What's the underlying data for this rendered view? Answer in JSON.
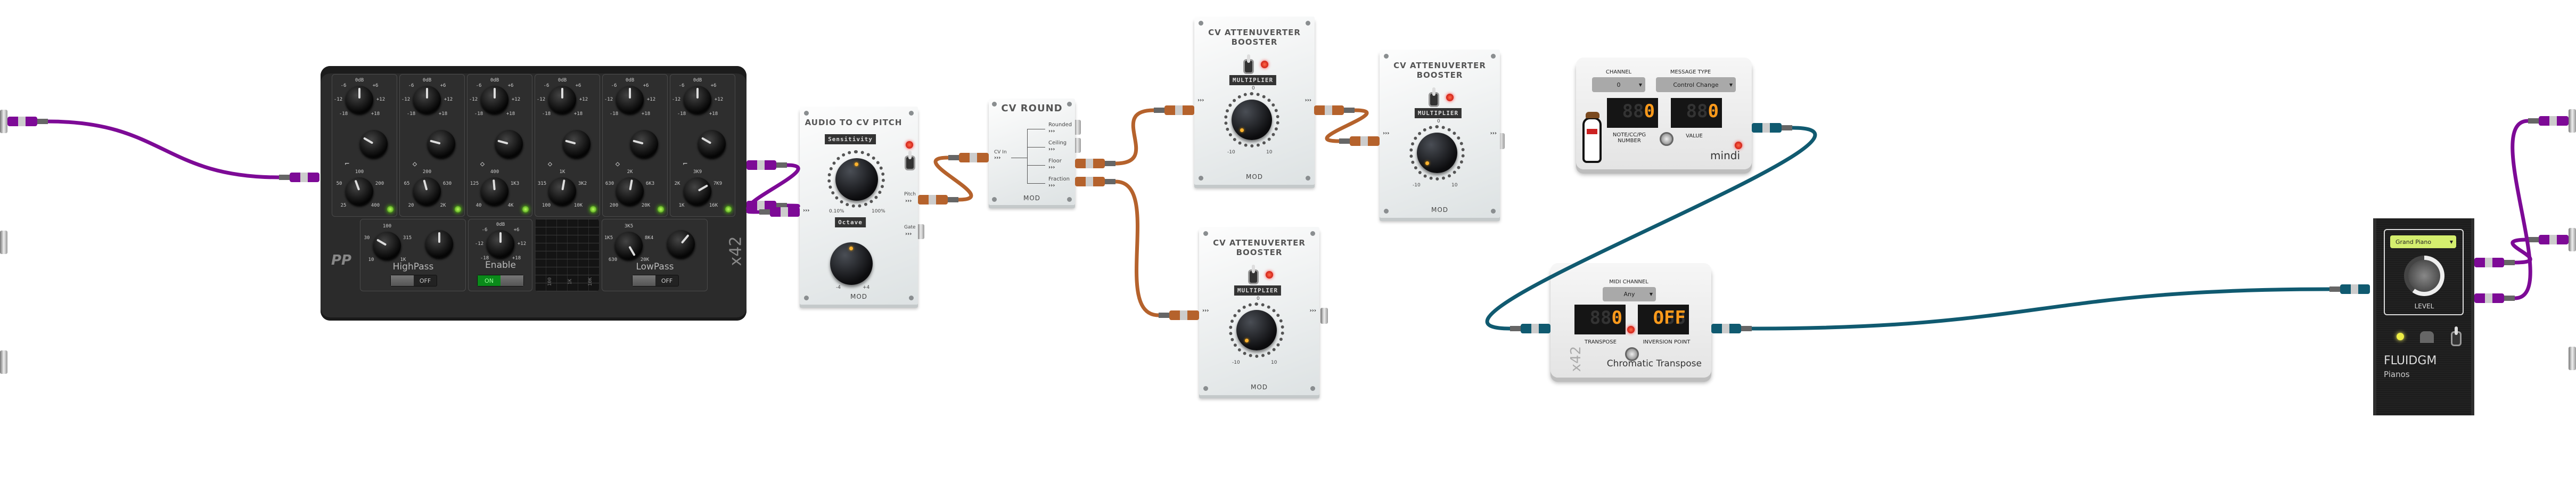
{
  "cable_colors": {
    "audio": "#7d0a96",
    "cv": "#b5622c",
    "midi": "#105a70"
  },
  "port_arrow": "›››",
  "eq": {
    "brand": "x42",
    "logo": "PP",
    "gain_labels": {
      "top": "0dB",
      "l1": "-6",
      "r1": "+6",
      "l2": "-12",
      "r2": "+12",
      "l3": "-18",
      "r3": "+18"
    },
    "bands": [
      {
        "freq": {
          "top": "100",
          "left": "50",
          "right": "200",
          "bl": "25",
          "br": "400"
        },
        "shape": "low-shelf",
        "enabled": true
      },
      {
        "freq": {
          "top": "200",
          "left": "65",
          "right": "630",
          "bl": "20",
          "br": "2K"
        },
        "shape": "peaking",
        "enabled": true
      },
      {
        "freq": {
          "top": "400",
          "left": "125",
          "right": "1K3",
          "bl": "40",
          "br": "4K"
        },
        "shape": "peaking",
        "enabled": true
      },
      {
        "freq": {
          "top": "1K",
          "left": "315",
          "right": "3K2",
          "bl": "100",
          "br": "10K"
        },
        "shape": "peaking",
        "enabled": true
      },
      {
        "freq": {
          "top": "2K",
          "left": "630",
          "right": "6K3",
          "bl": "200",
          "br": "20K"
        },
        "shape": "peaking",
        "enabled": true
      },
      {
        "freq": {
          "top": "3K9",
          "left": "2K",
          "right": "7K9",
          "bl": "1K",
          "br": "16K"
        },
        "shape": "high-shelf",
        "enabled": true
      }
    ],
    "highpass": {
      "label": "HighPass",
      "freq": {
        "top": "100",
        "left": "30",
        "right": "315",
        "bl": "10",
        "br": "1K"
      },
      "toggle": "OFF"
    },
    "enable": {
      "label": "Enable",
      "toggle": "ON"
    },
    "graph": {
      "ticks": [
        "100",
        "1K",
        "10K"
      ]
    },
    "lowpass": {
      "label": "LowPass",
      "freq": {
        "top": "3K5",
        "left": "1K5",
        "right": "8K4",
        "bl": "630",
        "br": "20K"
      },
      "toggle": "OFF"
    }
  },
  "audio_to_cv": {
    "title": "AUDIO TO CV PITCH",
    "sensitivity_label": "Sensitivity",
    "sens_min": "0.10%",
    "sens_max": "100%",
    "octave_label": "Octave",
    "oct_min": "-4",
    "oct_max": "+4",
    "out_pitch": "Pitch",
    "out_gate": "Gate",
    "brand": "MOD"
  },
  "cv_round": {
    "title": "CV ROUND",
    "input": "CV In",
    "outputs": [
      "Rounded",
      "Ceiling",
      "Floor",
      "Fraction"
    ],
    "brand": "MOD"
  },
  "attenuverters": [
    {
      "title1": "CV ATTENUVERTER",
      "title2": "BOOSTER",
      "param": "MULTIPLIER",
      "zero": "0",
      "min": "-10",
      "max": "10",
      "brand": "MOD"
    },
    {
      "title1": "CV ATTENUVERTER",
      "title2": "BOOSTER",
      "param": "MULTIPLIER",
      "zero": "0",
      "min": "-10",
      "max": "10",
      "brand": "MOD"
    },
    {
      "title1": "CV ATTENUVERTER",
      "title2": "BOOSTER",
      "param": "MULTIPLIER",
      "zero": "0",
      "min": "-10",
      "max": "10",
      "brand": "MOD"
    }
  ],
  "mindi": {
    "channel_label": "CHANNEL",
    "channel_value": "0",
    "msg_label": "MESSAGE TYPE",
    "msg_value": "Control Change",
    "number_label": "NOTE/CC/PG\nNUMBER",
    "number_display": "0",
    "value_label": "VALUE",
    "value_display": "0",
    "name": "mindi"
  },
  "chromatic": {
    "channel_label": "MIDI CHANNEL",
    "channel_value": "Any",
    "transpose_label": "TRANSPOSE",
    "transpose_display": "0",
    "inversion_label": "INVERSION POINT",
    "inversion_display": "OFF",
    "name": "Chromatic Transpose",
    "brand": "x42"
  },
  "fluidgm": {
    "preset": "Grand Piano",
    "level_label": "LEVEL",
    "name": "FLUIDGM",
    "subtitle": "Pianos"
  }
}
